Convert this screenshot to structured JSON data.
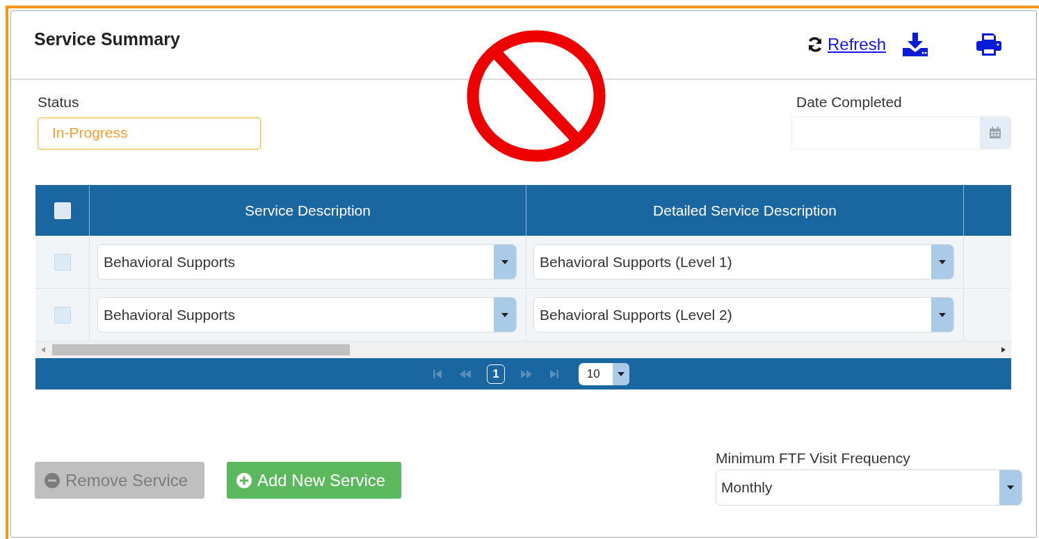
{
  "panel": {
    "title": "Service Summary",
    "refresh_link": "Refresh"
  },
  "status": {
    "label": "Status",
    "value": "In-Progress"
  },
  "date_completed": {
    "label": "Date Completed"
  },
  "table": {
    "select_all": {
      "checked": false
    },
    "columns": [
      "Service Description",
      "Detailed Service Description"
    ],
    "rows": [
      {
        "checked": false,
        "service": "Behavioral Supports",
        "detail": "Behavioral Supports (Level 1)"
      },
      {
        "checked": false,
        "service": "Behavioral Supports",
        "detail": "Behavioral Supports (Level 2)"
      }
    ],
    "pager": {
      "page": "1",
      "page_size": "10"
    }
  },
  "actions": [
    {
      "kind": "remove",
      "label": "Remove Service",
      "disabled": true
    },
    {
      "kind": "add",
      "label": "Add New Service",
      "disabled": false
    }
  ],
  "visit_frequency": {
    "label": "Minimum FTF Visit Frequency",
    "value": "Monthly"
  },
  "overlay": {
    "kind": "prohibited"
  }
}
